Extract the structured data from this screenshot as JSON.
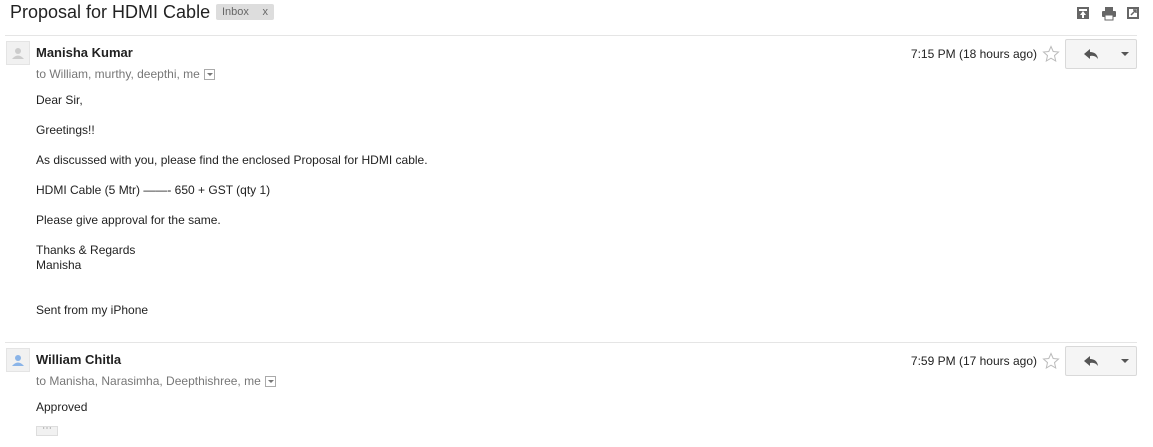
{
  "thread": {
    "subject": "Proposal for HDMI Cable",
    "label": "Inbox",
    "label_remove": "x",
    "icons": [
      "collapse-all-icon",
      "print-icon",
      "new-window-icon"
    ]
  },
  "messages": [
    {
      "sender": "Manisha Kumar",
      "recipients": "to William, murthy, deepthi, me",
      "time": "7:15 PM (18 hours ago)",
      "body": [
        "Dear Sir,",
        "Greetings!!",
        "As discussed with you, please find the enclosed Proposal for HDMI cable.",
        "HDMI Cable (5 Mtr) ——- 650 + GST (qty 1)",
        "Please give approval for the same.",
        "Thanks & Regards",
        "Manisha",
        "Sent from my iPhone"
      ]
    },
    {
      "sender": "William Chitla",
      "recipients": "to Manisha, Narasimha, Deepthishree, me",
      "time": "7:59 PM (17 hours ago)",
      "body": [
        "Approved"
      ],
      "trimmed_content_label": "⋯"
    }
  ],
  "colors": {
    "label_bg": "#dddddd",
    "avatar_blue": "#8ab4e8",
    "avatar_gray": "#cccccc"
  }
}
